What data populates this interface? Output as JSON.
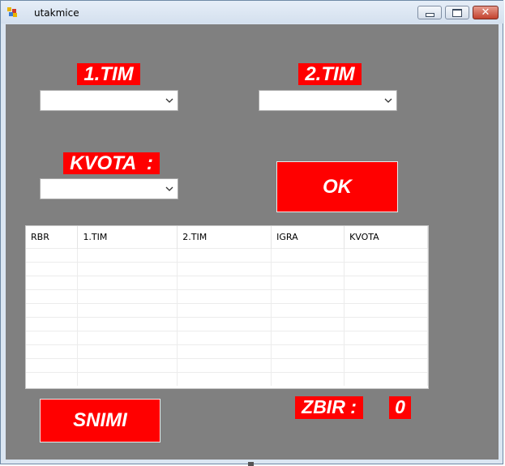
{
  "window": {
    "title": "utakmice"
  },
  "form": {
    "team1_label": "1.TIM",
    "team2_label": "2.TIM",
    "odds_label": "KVOTA  :",
    "ok_button": "OK",
    "save_button": "SNIMI",
    "sum_label": "ZBIR :",
    "sum_value": "0"
  },
  "grid": {
    "columns": [
      "RBR",
      "1.TIM",
      "2.TIM",
      "IGRA",
      "KVOTA"
    ],
    "rows": []
  },
  "colors": {
    "client_background": "#808080",
    "accent_red": "#ff0000",
    "label_text": "#ffffff"
  }
}
